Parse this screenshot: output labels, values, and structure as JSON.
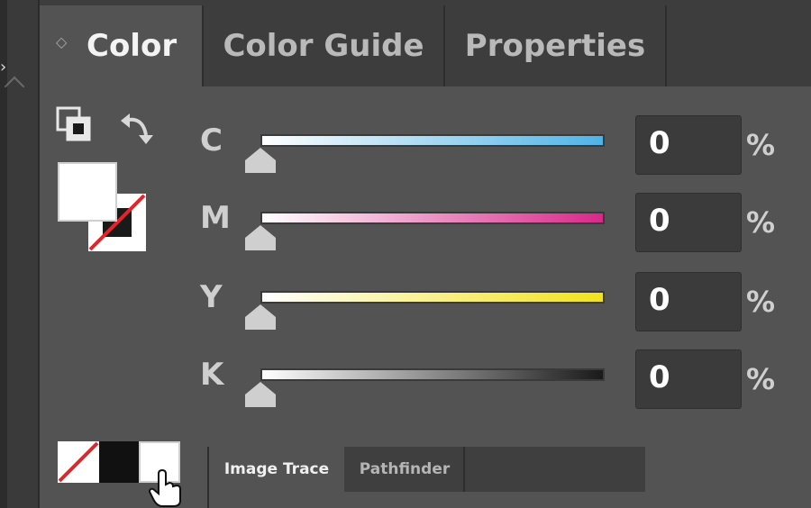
{
  "tabs": [
    {
      "label": "Color",
      "active": true
    },
    {
      "label": "Color Guide",
      "active": false
    },
    {
      "label": "Properties",
      "active": false
    }
  ],
  "sliders": [
    {
      "label": "C",
      "value": "0",
      "unit": "%",
      "gradient_end": "#4fb3e6"
    },
    {
      "label": "M",
      "value": "0",
      "unit": "%",
      "gradient_end": "#d8288a"
    },
    {
      "label": "Y",
      "value": "0",
      "unit": "%",
      "gradient_end": "#f2e21c"
    },
    {
      "label": "K",
      "value": "0",
      "unit": "%",
      "gradient_end": "#1a1a1a"
    }
  ],
  "fill_stroke": {
    "fill_color": "#ffffff",
    "stroke": "none"
  },
  "quick_swatches": [
    "none",
    "black",
    "white"
  ],
  "icons": [
    "default-fill-stroke-icon",
    "swap-fill-stroke-icon",
    "panel-grip-icon",
    "hand-cursor-icon"
  ],
  "bottom_tabs": [
    {
      "label": "Image Trace",
      "active": true
    },
    {
      "label": "Pathfinder",
      "active": false
    }
  ]
}
